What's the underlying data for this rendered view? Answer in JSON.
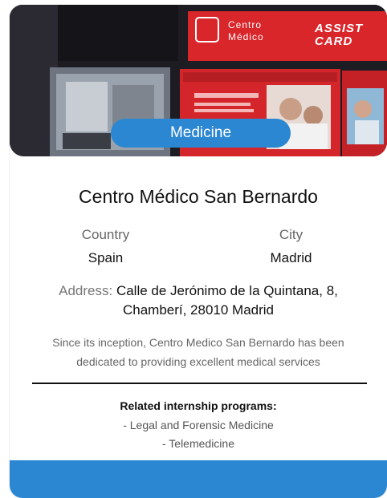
{
  "card": {
    "image_alt": "Centro Médico storefront",
    "sign_text_1": "Centro Médico",
    "sign_text_2": "ASSIST CARD",
    "category": "Medicine",
    "title": "Centro Médico San Bernardo",
    "country_label": "Country",
    "country_value": "Spain",
    "city_label": "City",
    "city_value": "Madrid",
    "address_label": "Address:",
    "address_value": "Calle de Jerónimo de la Quintana, 8, Chamberí, 28010 Madrid",
    "description": "Since its inception, Centro Medico San Bernardo has been dedicated to providing excellent medical services",
    "related_title": "Related internship programs:",
    "related_programs": [
      "- Legal and Forensic Medicine",
      "- Telemedicine"
    ]
  },
  "colors": {
    "accent": "#2c87d2",
    "sign_red": "#e0262a",
    "text_primary": "#111111",
    "text_muted": "#666666"
  }
}
